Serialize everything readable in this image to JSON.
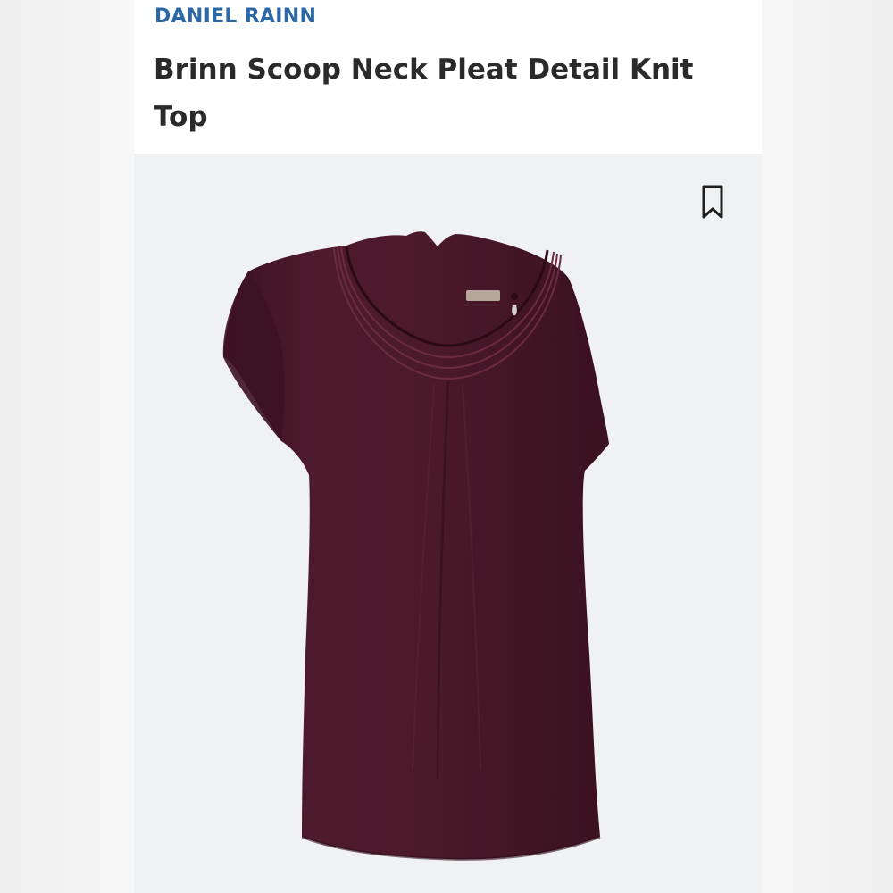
{
  "product": {
    "brand": "DANIEL RAINN",
    "title": "Brinn Scoop Neck Pleat Detail Knit Top"
  },
  "actions": {
    "bookmark_icon": "bookmark-icon"
  },
  "image": {
    "garment_color": "#4c1a2b",
    "background_color": "#f0f1f3"
  },
  "colors": {
    "brand": "#2c68a8",
    "title": "#2a2a2a"
  }
}
